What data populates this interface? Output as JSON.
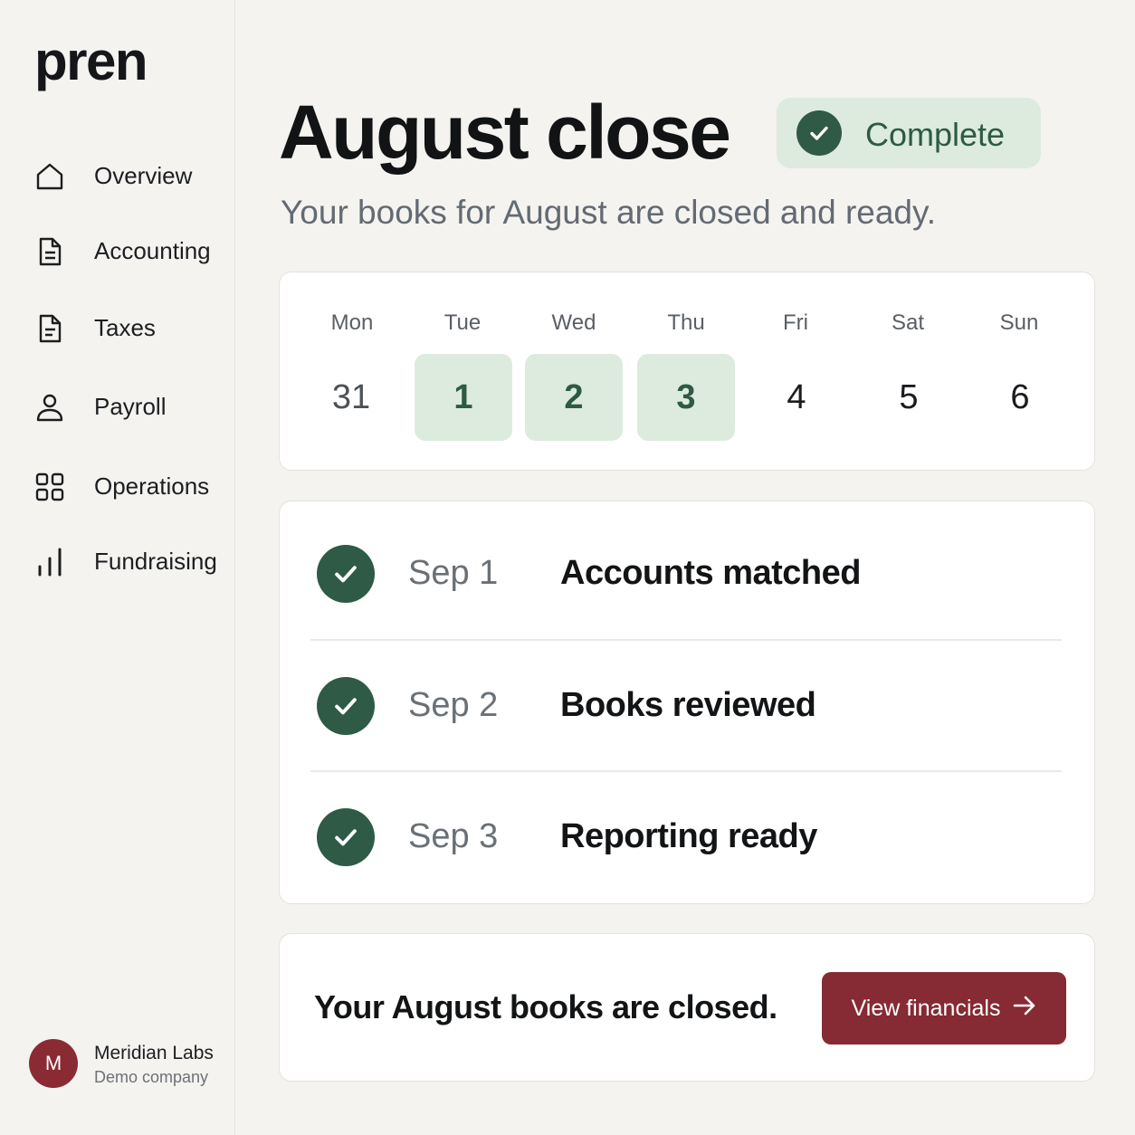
{
  "brand": "pren",
  "sidebar": {
    "items": [
      {
        "label": "Overview",
        "icon": "home-icon"
      },
      {
        "label": "Accounting",
        "icon": "document-icon"
      },
      {
        "label": "Taxes",
        "icon": "document-icon"
      },
      {
        "label": "Payroll",
        "icon": "user-icon"
      },
      {
        "label": "Operations",
        "icon": "grid-icon"
      },
      {
        "label": "Fundraising",
        "icon": "bar-chart-icon"
      }
    ],
    "account": {
      "initial": "M",
      "name": "Meridian Labs",
      "subtitle": "Demo company"
    }
  },
  "header": {
    "title": "August close",
    "status": "Complete",
    "subtitle": "Your books for August are closed and ready."
  },
  "week": {
    "days": [
      {
        "name": "Mon",
        "date": "31",
        "state": "dim"
      },
      {
        "name": "Tue",
        "date": "1",
        "state": "closed"
      },
      {
        "name": "Wed",
        "date": "2",
        "state": "closed"
      },
      {
        "name": "Thu",
        "date": "3",
        "state": "closed"
      },
      {
        "name": "Fri",
        "date": "4",
        "state": "normal"
      },
      {
        "name": "Sat",
        "date": "5",
        "state": "normal"
      },
      {
        "name": "Sun",
        "date": "6",
        "state": "normal"
      }
    ]
  },
  "steps": [
    {
      "date": "Sep 1",
      "name": "Accounts matched"
    },
    {
      "date": "Sep 2",
      "name": "Books reviewed"
    },
    {
      "date": "Sep 3",
      "name": "Reporting ready"
    }
  ],
  "footer": {
    "message": "Your August books are closed.",
    "button_label": "View financials"
  },
  "colors": {
    "accent_green": "#2f5a45",
    "highlight_green": "#dcebdd",
    "brand_red": "#862a33"
  }
}
